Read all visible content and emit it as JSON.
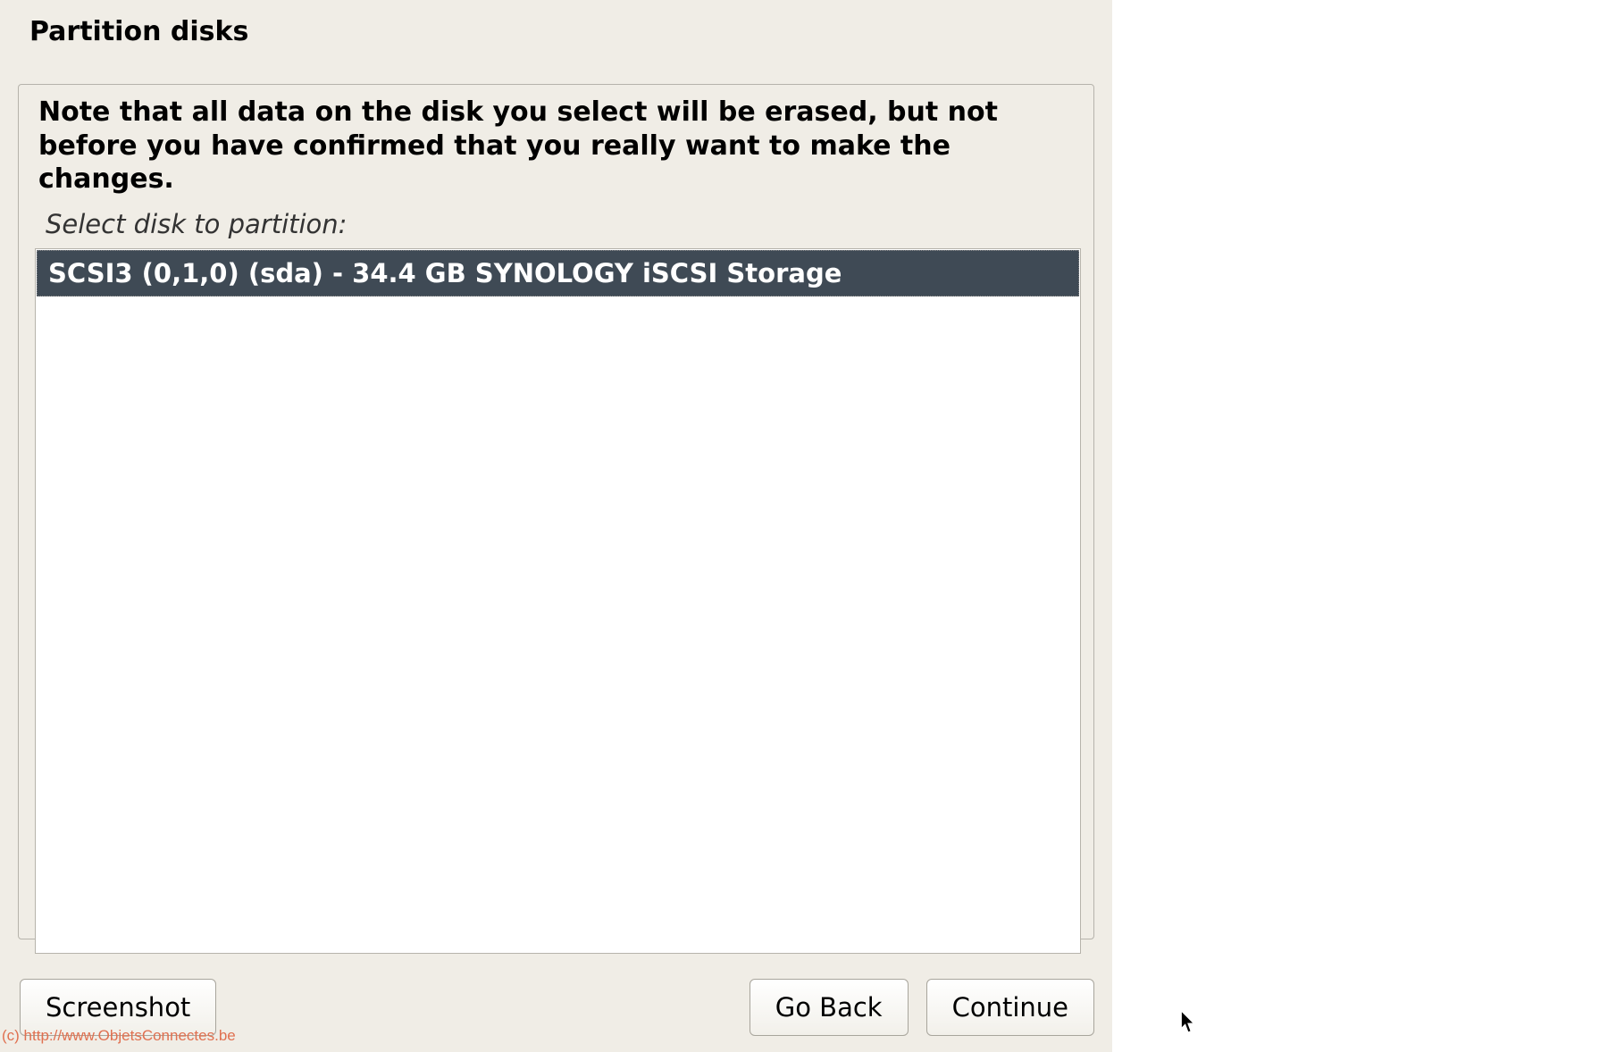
{
  "header": {
    "title": "Partition disks"
  },
  "main": {
    "warning": "Note that all data on the disk you select will be erased, but not before you have confirmed that you really want to make the changes.",
    "select_prompt": "Select disk to partition:",
    "disks": [
      {
        "label": "SCSI3 (0,1,0) (sda) - 34.4 GB SYNOLOGY iSCSI Storage",
        "selected": true
      }
    ]
  },
  "buttons": {
    "screenshot": "Screenshot",
    "go_back": "Go Back",
    "continue": "Continue"
  },
  "watermark": "(c) http://www.ObjetsConnectes.be"
}
